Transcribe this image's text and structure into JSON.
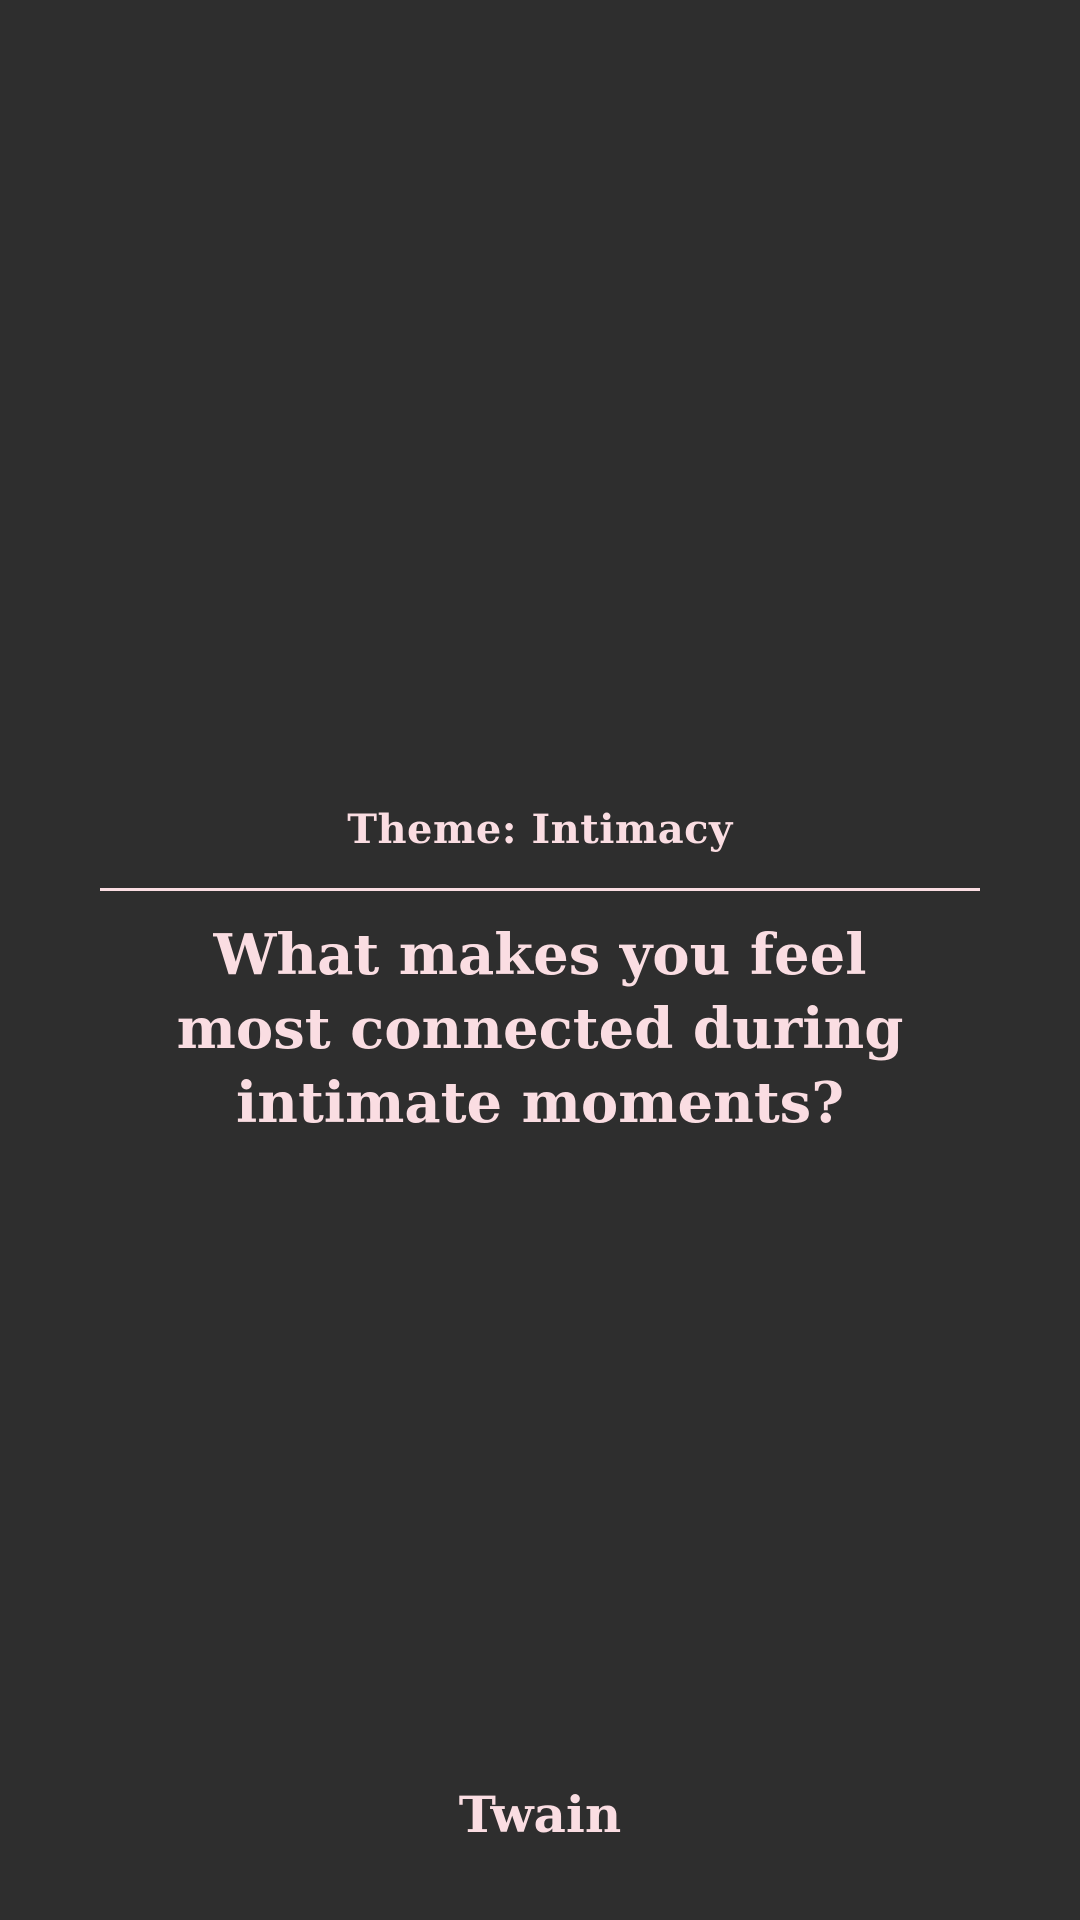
{
  "card": {
    "theme_label": "Theme: Intimacy",
    "question": "What makes you feel most connected during intimate moments?",
    "brand": "Twain"
  },
  "colors": {
    "background": "#2e2e2e",
    "text": "#fadde2",
    "divider": "#fadde2"
  }
}
